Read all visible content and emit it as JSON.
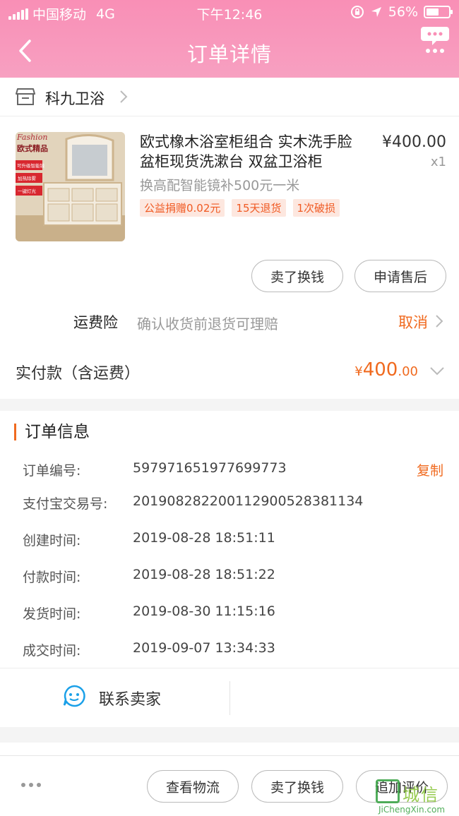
{
  "status_bar": {
    "carrier": "中国移动",
    "network": "4G",
    "time": "下午12:46",
    "battery_pct": "56%",
    "battery_level": 0.56
  },
  "nav": {
    "title": "订单详情"
  },
  "shop": {
    "name": "科九卫浴"
  },
  "product": {
    "title": "欧式橡木浴室柜组合 实木洗手脸盆柜现货洗漱台 双盆卫浴柜",
    "price": "¥400.00",
    "qty": "x1",
    "spec": "换高配智能镜补500元一米",
    "tags": [
      "公益捐赠0.02元",
      "15天退货",
      "1次破损"
    ],
    "thumb_text": {
      "brand": "Fashion",
      "heading": "欧式精品",
      "lines": [
        "可升级智能镜",
        "加热除雾",
        "一键灯光"
      ]
    },
    "buttons": {
      "sell": "卖了换钱",
      "after_sale": "申请售后"
    }
  },
  "insurance": {
    "label": "运费险",
    "desc": "确认收货前退货可理赔",
    "action": "取消"
  },
  "paid": {
    "label": "实付款（含运费）",
    "currency": "¥",
    "amount_int": "400",
    "amount_dec": ".00"
  },
  "order_info": {
    "title": "订单信息",
    "rows": [
      {
        "key": "订单编号:",
        "value": "597971651977699773"
      },
      {
        "key": "支付宝交易号:",
        "value": "2019082822001129005283811​34"
      },
      {
        "key": "创建时间:",
        "value": "2019-08-28 18:51:11"
      },
      {
        "key": "付款时间:",
        "value": "2019-08-28 18:51:22"
      },
      {
        "key": "发货时间:",
        "value": "2019-08-30 11:15:16"
      },
      {
        "key": "成交时间:",
        "value": "2019-09-07 13:34:33"
      }
    ],
    "copy_label": "复制",
    "contact_label": "联系卖家"
  },
  "bottom_bar": {
    "logistics": "查看物流",
    "sell": "卖了换钱",
    "review": "追加评价"
  },
  "watermark": {
    "text": "城信",
    "url": "JiChengXin.com"
  },
  "colors": {
    "header": "#f98fb6",
    "accent": "#f06a1f",
    "tag_bg": "#fde7df"
  }
}
